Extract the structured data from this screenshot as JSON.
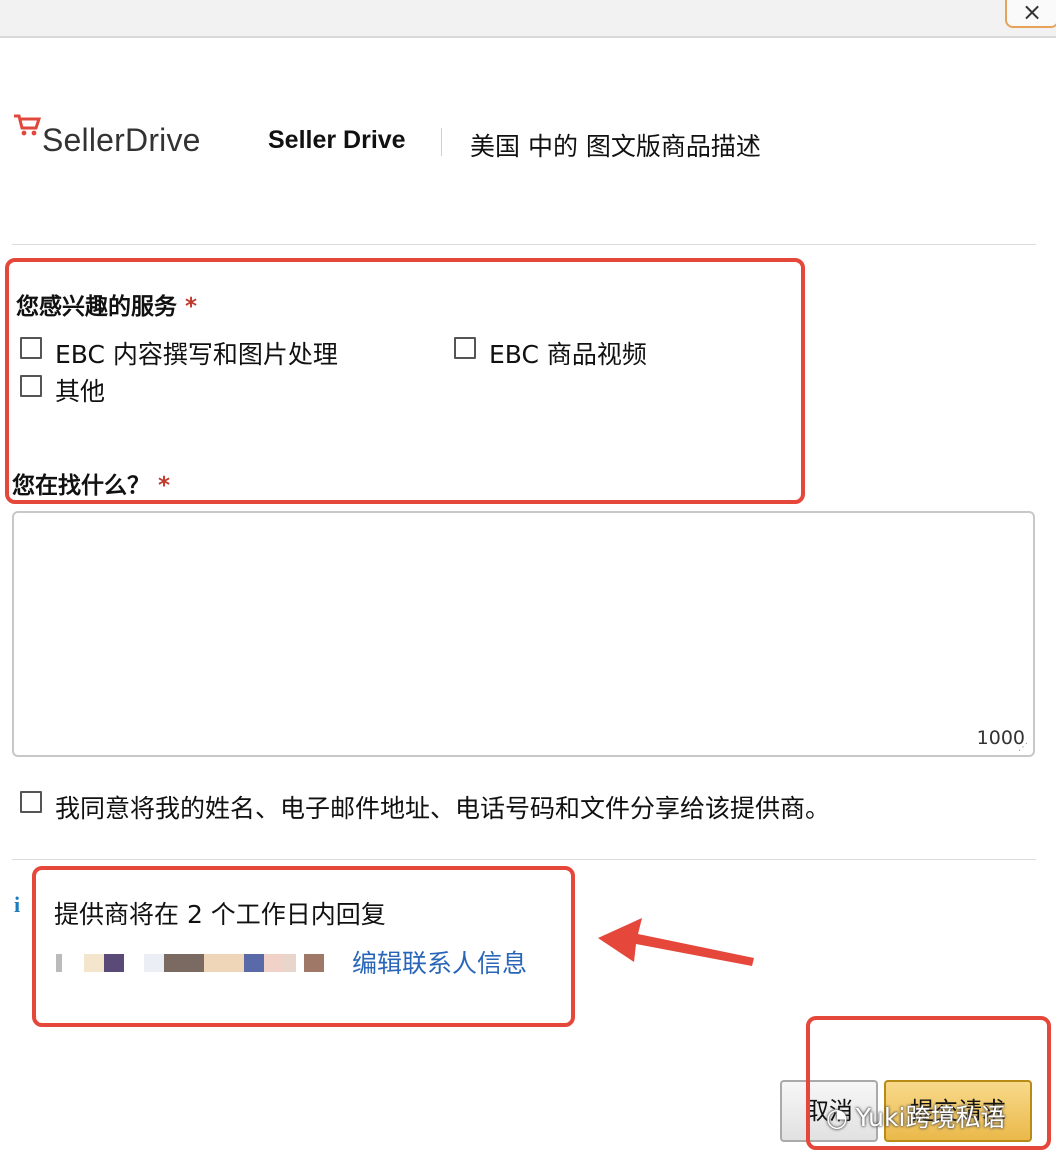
{
  "window": {
    "close_label": "×"
  },
  "header": {
    "logo_text": "SellerDrive",
    "provider_name": "Seller Drive",
    "subtitle": "美国 中的 图文版商品描述"
  },
  "services": {
    "label": "您感兴趣的服务",
    "required_mark": "*",
    "options": [
      {
        "label": "EBC 内容撰写和图片处理",
        "checked": false
      },
      {
        "label": "EBC 商品视频",
        "checked": false
      },
      {
        "label": "其他",
        "checked": false
      }
    ]
  },
  "looking_for": {
    "label": "您在找什么？",
    "required_mark": "*",
    "value": "",
    "char_counter": "1000"
  },
  "consent": {
    "label": "我同意将我的姓名、电子邮件地址、电话号码和文件分享给该提供商。",
    "checked": false
  },
  "reply_info": {
    "info_icon": "i",
    "text": "提供商将在 2 个工作日内回复",
    "edit_link": "编辑联系人信息"
  },
  "buttons": {
    "cancel_label": "取消",
    "submit_label": "提交请求"
  },
  "watermark": {
    "text": "Yuki跨境私语"
  },
  "colors": {
    "highlight": "#e5473a",
    "link": "#2a66b8",
    "submit_bg": "#eab94a"
  }
}
